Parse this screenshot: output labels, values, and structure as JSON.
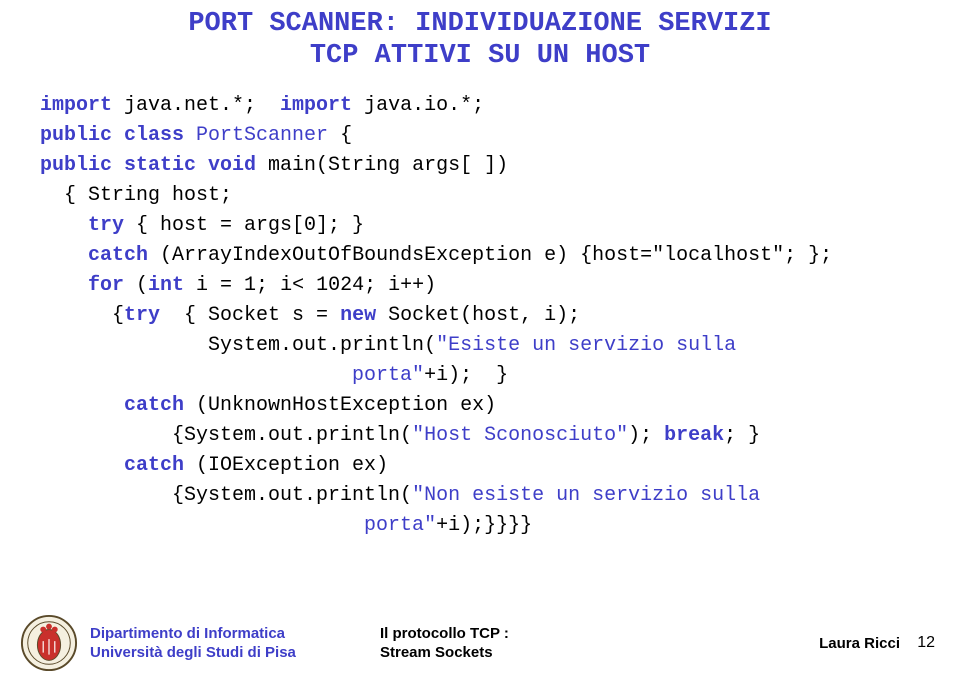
{
  "title_line1": "PORT SCANNER: INDIVIDUAZIONE SERVIZI",
  "title_line2": "TCP ATTIVI SU UN HOST",
  "code": {
    "l1a": "import",
    "l1b": " java.net.*;  ",
    "l1c": "import",
    "l1d": " java.io.*;",
    "l2a": "public class",
    "l2b": " PortScanner",
    "l2c": " {",
    "l3a": "public static void",
    "l3b": " main(String args[ ])",
    "l4": "  { String host;",
    "l5a": "    try",
    "l5b": " { host = args[0]; }",
    "l6a": "    catch",
    "l6b": " (ArrayIndexOutOfBoundsException e) {host=\"localhost\"; };",
    "l7a": "    for",
    "l7b": " (",
    "l7c": "int",
    "l7d": " i = 1; i< 1024; i++)",
    "l8a": "      {",
    "l8b": "try",
    "l8c": "  { Socket s = ",
    "l8d": "new",
    "l8e": " Socket(host, i);",
    "l9a": "              System.out.println(",
    "l9b": "\"Esiste un servizio sulla ",
    "l10a": "                          porta\"",
    "l10b": "+i);  }",
    "l11a": "       catch",
    "l11b": " (UnknownHostException ex)",
    "l12a": "           {System.out.println(",
    "l12b": "\"Host Sconosciuto\"",
    "l12c": "); ",
    "l12d": "break",
    "l12e": "; }",
    "l13a": "       catch",
    "l13b": " (IOException ex)",
    "l14a": "           {System.out.println(",
    "l14b": "\"Non esiste un servizio sulla ",
    "l15a": "                           porta\"",
    "l15b": "+i);}}}}"
  },
  "footer": {
    "dept1": "Dipartimento di Informatica",
    "dept2": "Università degli Studi di Pisa",
    "center1": "Il protocollo TCP :",
    "center2": "Stream Sockets",
    "author": "Laura Ricci",
    "page": "12"
  }
}
